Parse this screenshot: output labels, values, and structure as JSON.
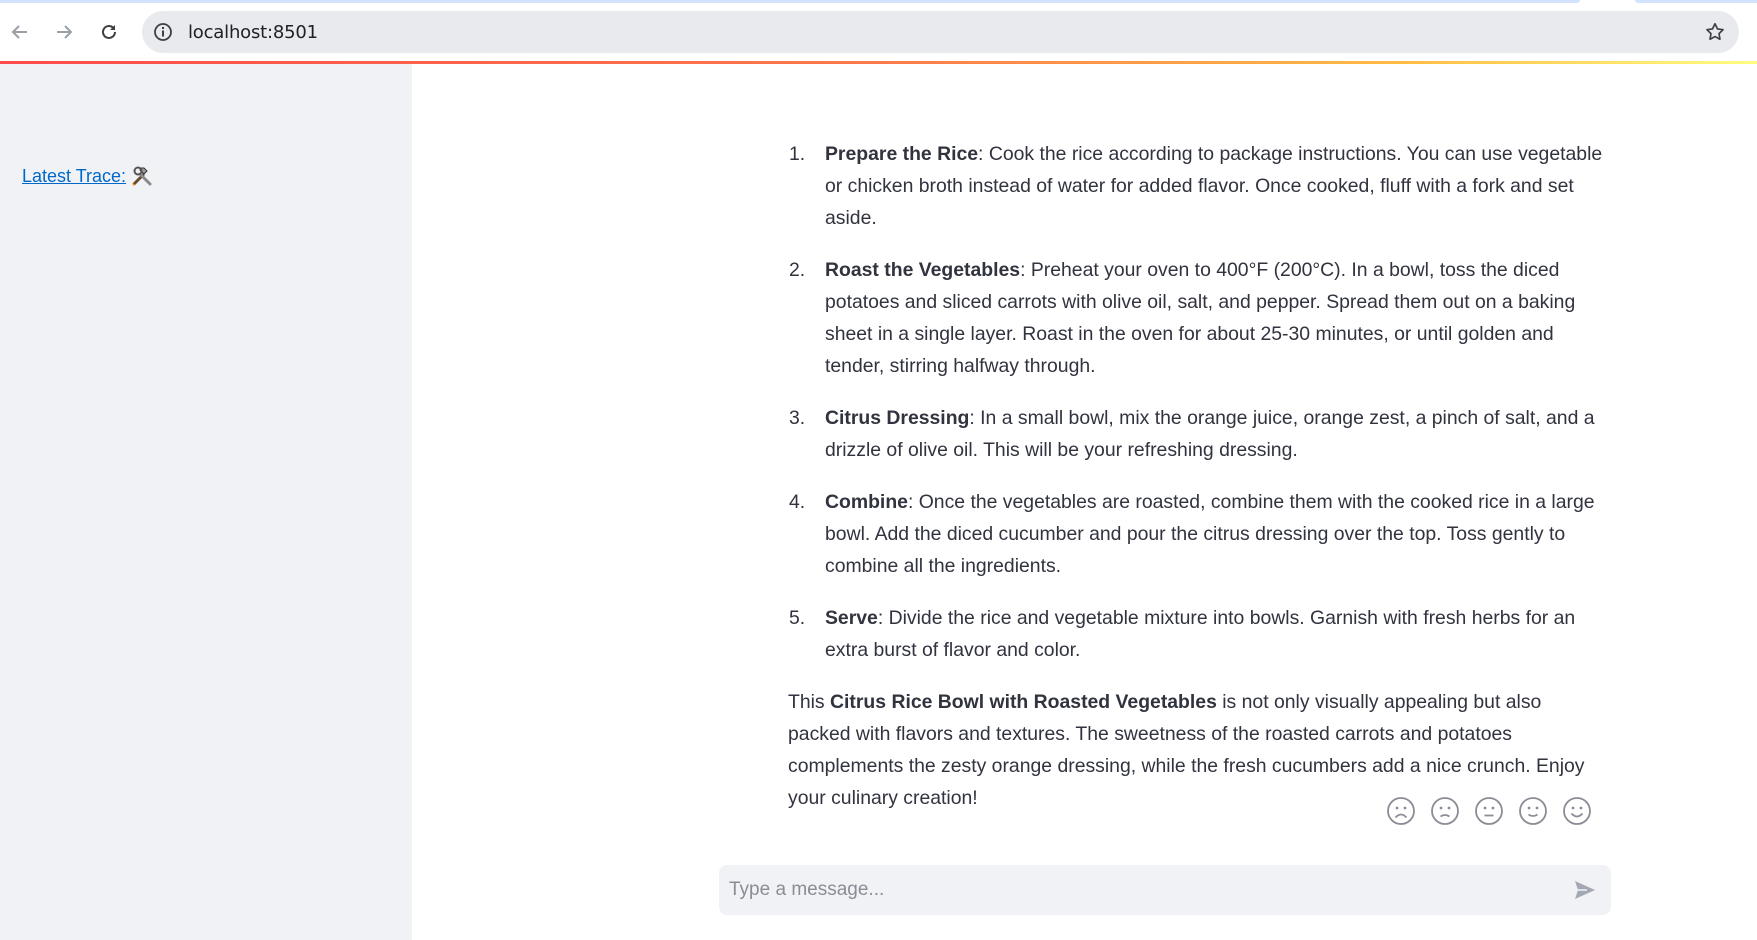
{
  "browser": {
    "url": "localhost:8501",
    "icons": {
      "back": "back-arrow-icon",
      "forward": "forward-arrow-icon",
      "reload": "reload-icon",
      "site_info": "info-icon",
      "bookmark": "star-icon"
    }
  },
  "sidebar": {
    "trace_link_label": "Latest Trace:",
    "trace_icon": "hammer-and-wrench-icon"
  },
  "main": {
    "steps": [
      {
        "num": "1.",
        "title": "Prepare the Rice",
        "text": ": Cook the rice according to package instructions. You can use vegetable or chicken broth instead of water for added flavor. Once cooked, fluff with a fork and set aside."
      },
      {
        "num": "2.",
        "title": "Roast the Vegetables",
        "text": ": Preheat your oven to 400°F (200°C). In a bowl, toss the diced potatoes and sliced carrots with olive oil, salt, and pepper. Spread them out on a baking sheet in a single layer. Roast in the oven for about 25-30 minutes, or until golden and tender, stirring halfway through."
      },
      {
        "num": "3.",
        "title": "Citrus Dressing",
        "text": ": In a small bowl, mix the orange juice, orange zest, a pinch of salt, and a drizzle of olive oil. This will be your refreshing dressing."
      },
      {
        "num": "4.",
        "title": "Combine",
        "text": ": Once the vegetables are roasted, combine them with the cooked rice in a large bowl. Add the diced cucumber and pour the citrus dressing over the top. Toss gently to combine all the ingredients."
      },
      {
        "num": "5.",
        "title": "Serve",
        "text": ": Divide the rice and vegetable mixture into bowls. Garnish with fresh herbs for an extra burst of flavor and color."
      }
    ],
    "closing": {
      "prefix": "This ",
      "bold": "Citrus Rice Bowl with Roasted Vegetables",
      "suffix": " is not only visually appealing but also packed with flavors and textures. The sweetness of the roasted carrots and potatoes complements the zesty orange dressing, while the fresh cucumbers add a nice crunch. Enjoy your culinary creation!"
    },
    "feedback_faces": [
      "very-sad-face-icon",
      "sad-face-icon",
      "neutral-face-icon",
      "happy-face-icon",
      "very-happy-face-icon"
    ],
    "chat_input": {
      "placeholder": "Type a message...",
      "send_icon": "send-icon"
    }
  },
  "colors": {
    "accent_link": "#0068c9",
    "sidebar_bg": "#f0f2f6",
    "text": "#31333f"
  }
}
